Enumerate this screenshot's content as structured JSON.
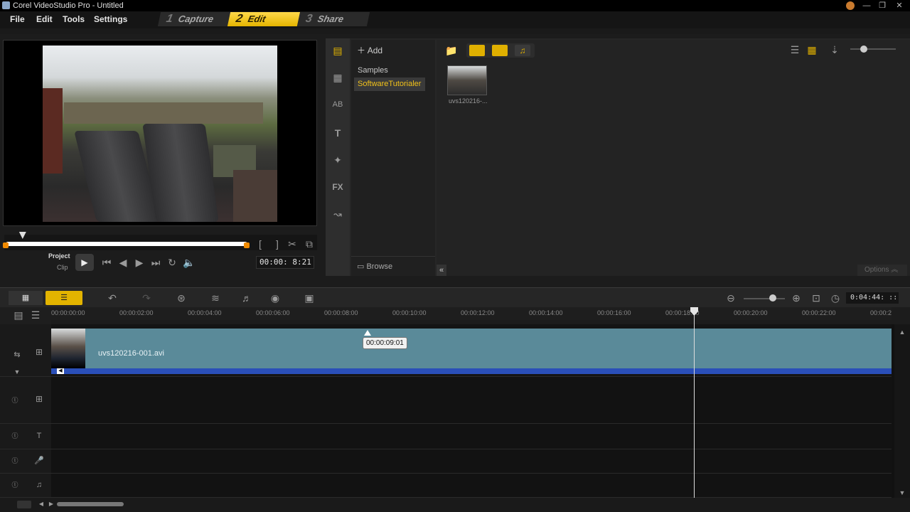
{
  "window": {
    "title": "Corel VideoStudio Pro - Untitled",
    "min_label": "—",
    "max_label": "❐",
    "close_label": "✕"
  },
  "menu": {
    "items": [
      "File",
      "Edit",
      "Tools",
      "Settings"
    ]
  },
  "steps": [
    {
      "num": "1",
      "label": "Capture"
    },
    {
      "num": "2",
      "label": "Edit"
    },
    {
      "num": "3",
      "label": "Share"
    }
  ],
  "player": {
    "project_label": "Project",
    "clip_label": "Clip",
    "timecode": "00:00: 8:21",
    "scrub_position": 0.07
  },
  "library": {
    "add_label": "Add",
    "folders": [
      "Samples",
      "SoftwareTutorialer"
    ],
    "browse_label": "Browse",
    "thumb_caption": "uvs120216-...",
    "options_label": "Options",
    "zoom_level": 0.3
  },
  "timeline": {
    "duration": "0:04:44: ::",
    "ruler": [
      "00:00:00:00",
      "00:00:02:00",
      "00:00:04:00",
      "00:00:06:00",
      "00:00:08:00",
      "00:00:10:00",
      "00:00:12:00",
      "00:00:14:00",
      "00:00:16:00",
      "00:00:18:00",
      "00:00:20:00",
      "00:00:22:00",
      "00:00:2"
    ],
    "clip_name": "uvs120216-001.avi",
    "tooltip": "00:00:09:01",
    "zoom_level": 0.7
  },
  "colors": {
    "accent": "#f2c21a",
    "clip": "#5a8a99",
    "audio": "#2a4fb8"
  }
}
